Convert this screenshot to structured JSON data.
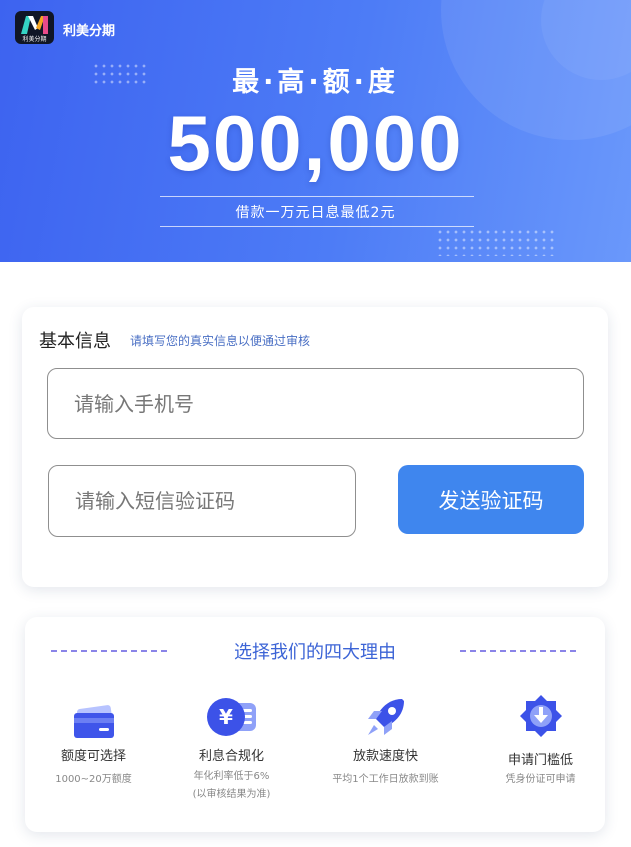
{
  "brand": {
    "logo_text": "利美分期",
    "name": "利美分期"
  },
  "hero": {
    "heading": "最·高·额·度",
    "amount": "500,000",
    "subtitle": "借款一万元日息最低2元"
  },
  "form": {
    "title": "基本信息",
    "hint": "请填写您的真实信息以便通过审核",
    "phone_placeholder": "请输入手机号",
    "phone_value": "",
    "sms_placeholder": "请输入短信验证码",
    "sms_value": "",
    "send_code_label": "发送验证码"
  },
  "reasons": {
    "title": "选择我们的四大理由",
    "items": [
      {
        "icon": "card-icon",
        "title": "额度可选择",
        "desc": "1000~20万额度",
        "desc2": ""
      },
      {
        "icon": "yen-coin-icon",
        "title": "利息合规化",
        "desc": "年化利率低于6%",
        "desc2": "(以审核结果为准)"
      },
      {
        "icon": "rocket-icon",
        "title": "放款速度快",
        "desc": "平均1个工作日放款到账",
        "desc2": ""
      },
      {
        "icon": "badge-download-icon",
        "title": "申请门槛低",
        "desc": "凭身份证可申请",
        "desc2": ""
      }
    ]
  },
  "colors": {
    "hero_gradient_start": "#3d63f0",
    "hero_gradient_end": "#6a98fb",
    "accent_button": "#3f86ee",
    "hint_text": "#4a6fc4",
    "reasons_title": "#3c64d6",
    "icon_blue": "#3b57ea"
  }
}
